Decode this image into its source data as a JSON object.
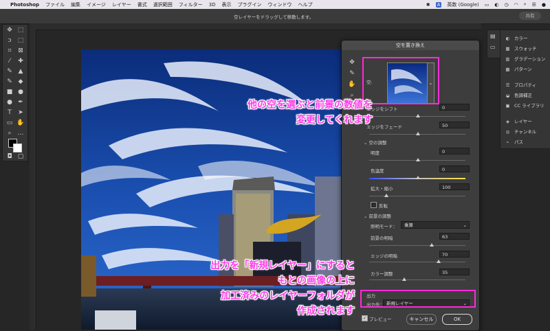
{
  "menubar": {
    "apple": "",
    "app_name": "Photoshop",
    "items": [
      "ファイル",
      "編集",
      "イメージ",
      "レイヤー",
      "書式",
      "選択範囲",
      "フィルター",
      "3D",
      "表示",
      "プラグイン",
      "ウィンドウ",
      "ヘルプ"
    ],
    "input_source": "英数 (Google)"
  },
  "options_bar": {
    "hint": "空レイヤーをドラッグして移動します。",
    "share_label": "共有"
  },
  "dialog": {
    "title": "空を置き換え",
    "sky_label": "空:",
    "edge_shift_label": "エッジをシフト",
    "edge_shift_value": "0",
    "edge_fade_label": "エッジをフェード",
    "edge_fade_value": "50",
    "sky_adjust_section": "空の調整",
    "brightness_label": "明度",
    "brightness_value": "0",
    "temperature_label": "色温度",
    "temperature_value": "0",
    "scale_label": "拡大・縮小",
    "scale_value": "100",
    "flip_label": "反転",
    "fg_adjust_section": "前景の調整",
    "lighting_mode_label": "照明モード：",
    "lighting_mode_value": "乗算",
    "fg_lighting_label": "前景の明暗",
    "fg_lighting_value": "63",
    "edge_lighting_label": "エッジの明暗",
    "edge_lighting_value": "70",
    "color_adjust_label": "カラー調整",
    "color_adjust_value": "35",
    "output_section": "出力",
    "output_to_label": "出力先：",
    "output_to_value": "新規レイヤー",
    "preview_label": "プレビュー",
    "cancel_label": "キャンセル",
    "ok_label": "OK"
  },
  "annotations": {
    "top_line1": "他の空を選ぶと前景の数値を",
    "top_line2": "変更してくれます",
    "bottom_line1": "出力を「新規レイヤー」にすると",
    "bottom_line2": "もとの画像の上に",
    "bottom_line3": "加工済みのレイヤーフォルダが",
    "bottom_line4": "作成されます"
  },
  "panels": {
    "items": [
      "カラー",
      "スウォッチ",
      "グラデーション",
      "パターン",
      "プロパティ",
      "色調補正",
      "CC ライブラリ",
      "レイヤー",
      "チャンネル",
      "パス"
    ]
  },
  "colors": {
    "highlight": "#ff2ad8",
    "annotation_text": "#ff3ce6",
    "dialog_bg": "#3d3d3d",
    "app_bg": "#262626"
  }
}
